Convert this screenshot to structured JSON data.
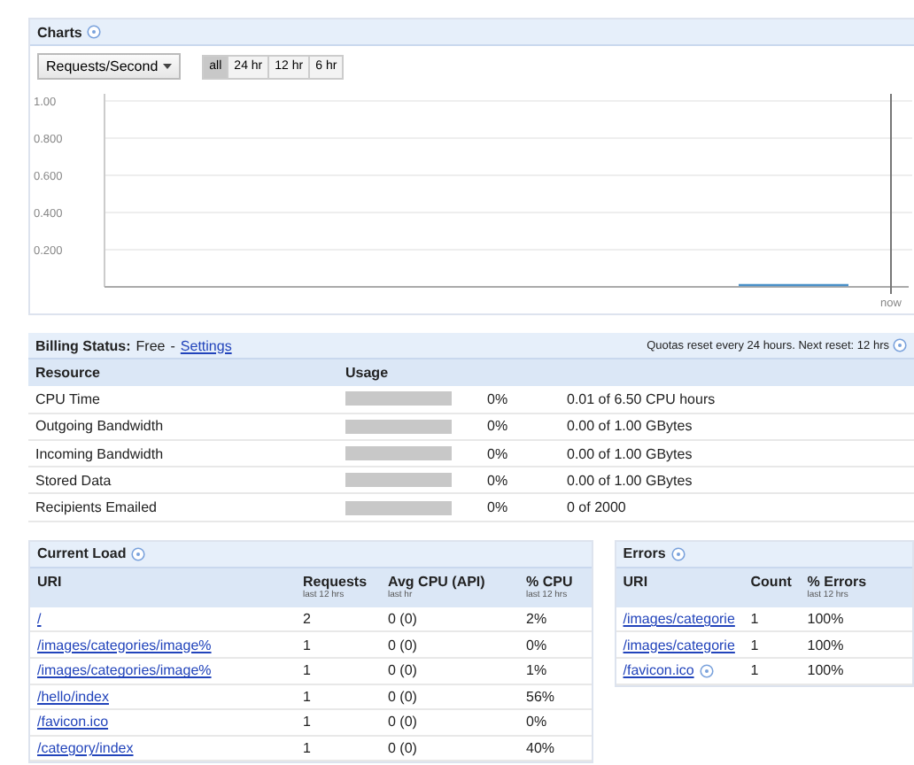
{
  "charts": {
    "title": "Charts",
    "metric_dropdown": "Requests/Second",
    "ranges": [
      {
        "label": "all",
        "selected": true
      },
      {
        "label": "24 hr",
        "selected": false
      },
      {
        "label": "12 hr",
        "selected": false
      },
      {
        "label": "6 hr",
        "selected": false
      }
    ],
    "y_axis_labels": [
      "1.00",
      "0.800",
      "0.600",
      "0.400",
      "0.200"
    ],
    "x_axis_label": "now"
  },
  "billing": {
    "status_label": "Billing Status:",
    "plan": "Free",
    "separator": "-",
    "settings_link": "Settings",
    "quota_note": "Quotas reset every 24 hours. Next reset: 12 hrs",
    "columns": [
      "Resource",
      "Usage"
    ],
    "rows": [
      {
        "resource": "CPU Time",
        "level": 0,
        "percent": "0%",
        "detail": "0.01 of 6.50 CPU hours"
      },
      {
        "resource": "Outgoing Bandwidth",
        "level": 0,
        "percent": "0%",
        "detail": "0.00 of 1.00 GBytes"
      },
      {
        "resource": "Incoming Bandwidth",
        "level": 0,
        "percent": "0%",
        "detail": "0.00 of 1.00 GBytes"
      },
      {
        "resource": "Stored Data",
        "level": 0,
        "percent": "0%",
        "detail": "0.00 of 1.00 GBytes"
      },
      {
        "resource": "Recipients Emailed",
        "level": 0,
        "percent": "0%",
        "detail": "0 of 2000"
      }
    ]
  },
  "current_load": {
    "title": "Current Load",
    "columns": [
      {
        "label": "URI"
      },
      {
        "label": "Requests",
        "sub": "last 12 hrs"
      },
      {
        "label": "Avg CPU (API)",
        "sub": "last hr"
      },
      {
        "label": "% CPU",
        "sub": "last 12 hrs"
      }
    ],
    "rows": [
      {
        "uri": "/",
        "requests": "2",
        "avg_cpu": "0 (0)",
        "cpu": "2%"
      },
      {
        "uri": "/images/categories/image%",
        "requests": "1",
        "avg_cpu": "0 (0)",
        "cpu": "0%"
      },
      {
        "uri": "/images/categories/image%",
        "requests": "1",
        "avg_cpu": "0 (0)",
        "cpu": "1%"
      },
      {
        "uri": "/hello/index",
        "requests": "1",
        "avg_cpu": "0 (0)",
        "cpu": "56%"
      },
      {
        "uri": "/favicon.ico",
        "requests": "1",
        "avg_cpu": "0 (0)",
        "cpu": "0%"
      },
      {
        "uri": "/category/index",
        "requests": "1",
        "avg_cpu": "0 (0)",
        "cpu": "40%"
      }
    ]
  },
  "errors": {
    "title": "Errors",
    "columns": [
      {
        "label": "URI"
      },
      {
        "label": "Count"
      },
      {
        "label": "% Errors",
        "sub": "last 12 hrs"
      }
    ],
    "rows": [
      {
        "uri": "/images/categorie",
        "help": false,
        "count": "1",
        "percent": "100%"
      },
      {
        "uri": "/images/categorie",
        "help": false,
        "count": "1",
        "percent": "100%"
      },
      {
        "uri": "/favicon.ico",
        "help": true,
        "count": "1",
        "percent": "100%"
      }
    ]
  }
}
